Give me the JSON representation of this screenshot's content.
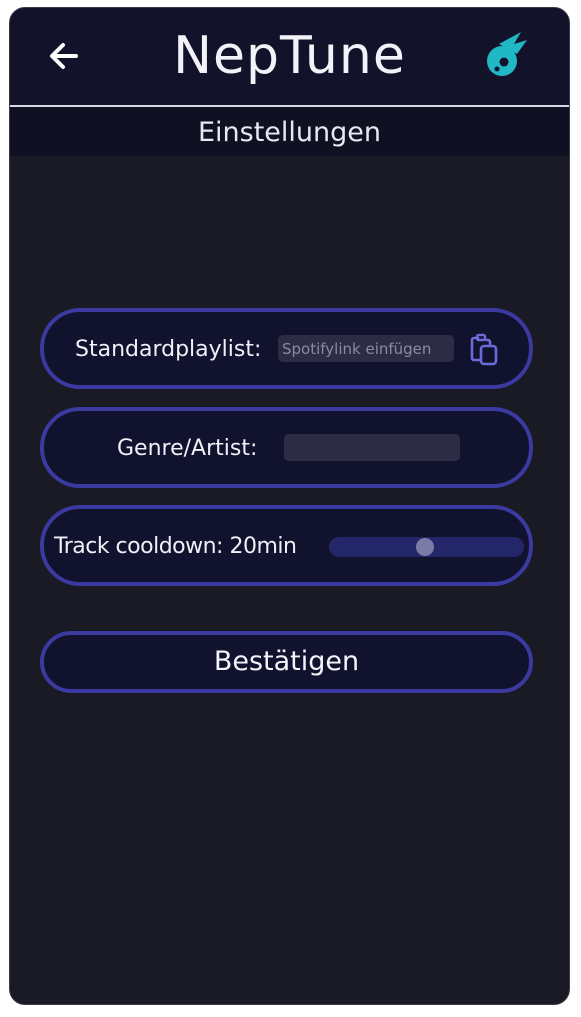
{
  "header": {
    "back_icon": "arrow-left-icon",
    "title": "NepTune",
    "logo_icon": "comet-planet-icon",
    "logo_color": "#1fb8c4"
  },
  "subheader": {
    "title": "Einstellungen"
  },
  "settings": {
    "playlist": {
      "label": "Standardplaylist:",
      "placeholder": "Spotifylink einfügen",
      "value": "",
      "paste_icon": "clipboard-paste-icon"
    },
    "genre": {
      "label": "Genre/Artist:",
      "placeholder": "",
      "value": ""
    },
    "cooldown": {
      "label": "Track cooldown: 20min",
      "slider_fraction": 0.49
    }
  },
  "confirm": {
    "label": "Bestätigen"
  },
  "colors": {
    "background": "#191a24",
    "header": "#12132a",
    "accent_border": "#3b3aa0",
    "icon_purple": "#6a6ad8"
  }
}
